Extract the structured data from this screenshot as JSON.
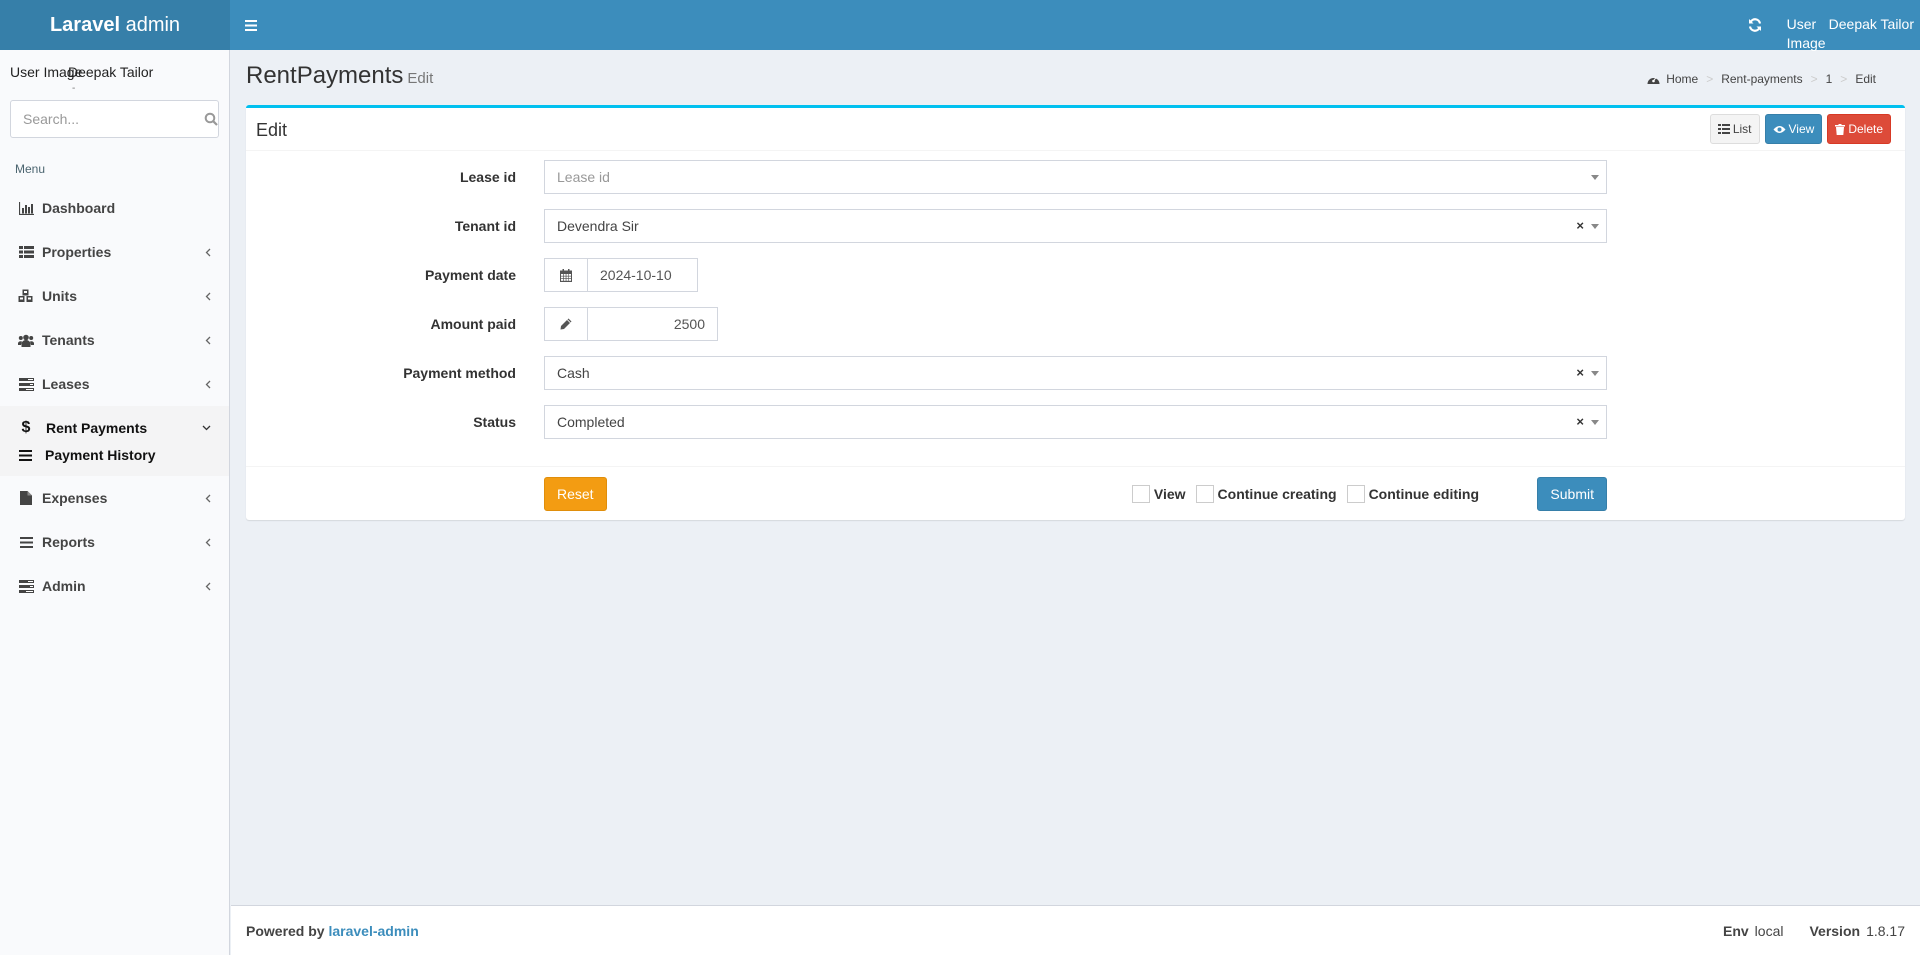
{
  "header": {
    "logo_bold": "Laravel",
    "logo_rest": " admin",
    "user_image_alt": "User Image",
    "user_name": "Deepak Tailor"
  },
  "sidebar": {
    "user_image_alt": "User Image",
    "user_name": "Deepak Tailor",
    "user_status": "-",
    "search_placeholder": "Search...",
    "menu_header": "Menu",
    "items": [
      {
        "label": "Dashboard",
        "icon": "bar-chart-icon",
        "has_children": false
      },
      {
        "label": "Properties",
        "icon": "list-icon",
        "has_children": true
      },
      {
        "label": "Units",
        "icon": "cubes-icon",
        "has_children": true
      },
      {
        "label": "Tenants",
        "icon": "users-icon",
        "has_children": true
      },
      {
        "label": "Leases",
        "icon": "tasks-icon",
        "has_children": true
      },
      {
        "label": "Rent Payments",
        "icon": "dollar-icon",
        "has_children": true,
        "expanded": true,
        "children": [
          {
            "label": "Payment History",
            "icon": "bars-icon"
          }
        ]
      },
      {
        "label": "Expenses",
        "icon": "file-icon",
        "has_children": true
      },
      {
        "label": "Reports",
        "icon": "bars-icon",
        "has_children": true
      },
      {
        "label": "Admin",
        "icon": "tasks-icon",
        "has_children": true
      }
    ]
  },
  "content": {
    "title": "RentPayments",
    "subtitle": "Edit",
    "breadcrumb": [
      "Home",
      "Rent-payments",
      "1",
      "Edit"
    ]
  },
  "box": {
    "title": "Edit",
    "tools": {
      "list": "List",
      "view": "View",
      "delete": "Delete"
    },
    "fields": [
      {
        "label": "Lease id",
        "type": "select",
        "value": "",
        "placeholder": "Lease id",
        "clearable": false
      },
      {
        "label": "Tenant id",
        "type": "select",
        "value": "Devendra Sir",
        "clearable": true
      },
      {
        "label": "Payment date",
        "type": "date",
        "value": "2024-10-10"
      },
      {
        "label": "Amount paid",
        "type": "number",
        "value": "2500"
      },
      {
        "label": "Payment method",
        "type": "select",
        "value": "Cash",
        "clearable": true
      },
      {
        "label": "Status",
        "type": "select",
        "value": "Completed",
        "clearable": true
      }
    ],
    "footer": {
      "reset": "Reset",
      "checks": [
        {
          "label": "View",
          "checked": false
        },
        {
          "label": "Continue creating",
          "checked": false
        },
        {
          "label": "Continue editing",
          "checked": false
        }
      ],
      "submit": "Submit"
    }
  },
  "footer": {
    "powered_by": "Powered by",
    "link": "laravel-admin",
    "env_label": "Env",
    "env_value": "local",
    "version_label": "Version",
    "version_value": "1.8.17"
  },
  "colors": {
    "header": "#3c8dbc",
    "logo_bg": "#367fa9",
    "box_accent": "#00c0ef",
    "primary": "#3c8dbc",
    "danger": "#dd4b39",
    "warning": "#f39c12"
  }
}
